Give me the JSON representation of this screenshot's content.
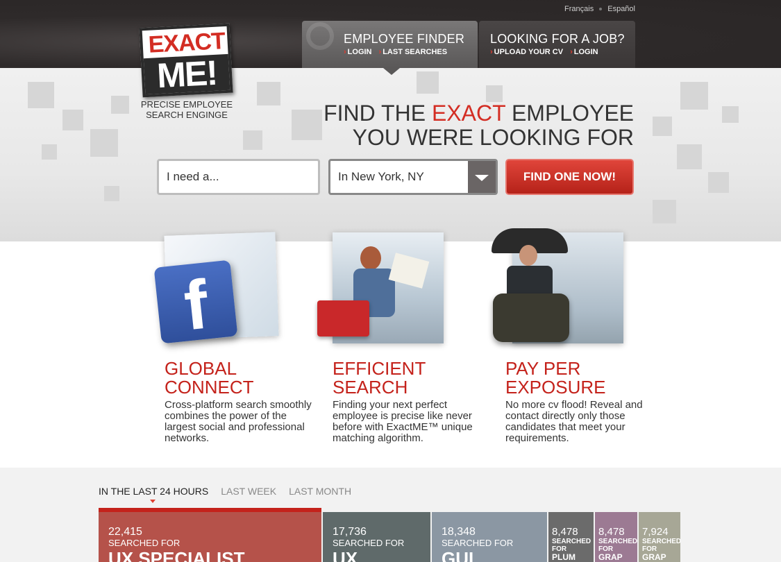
{
  "languages": [
    "Français",
    "Español"
  ],
  "logo": {
    "line1": "EXACT",
    "line2": "ME!",
    "tagline_line1": "PRECISE EMPLOYEE",
    "tagline_line2": "SEARCH ENGINGE"
  },
  "tabs": {
    "employee": {
      "title": "EMPLOYEE FINDER",
      "links": [
        "LOGIN",
        "LAST SEARCHES"
      ]
    },
    "job": {
      "title": "LOOKING FOR A JOB?",
      "links": [
        "UPLOAD YOUR CV",
        "LOGIN"
      ]
    }
  },
  "headline": {
    "pre": "FIND THE ",
    "highlight": "EXACT",
    "post": " EMPLOYEE",
    "line2": "YOU WERE LOOKING FOR"
  },
  "search": {
    "need_placeholder": "I need a...",
    "location": "In New York, NY",
    "button": "FIND ONE NOW!"
  },
  "features": [
    {
      "title1": "GLOBAL",
      "title2": "CONNECT",
      "desc": "Cross-platform search smoothly combines the power of the largest social and professional networks.",
      "icon": "facebook-icon"
    },
    {
      "title1": "EFFICIENT",
      "title2": "SEARCH",
      "desc": "Finding your next perfect employee is precise like never before with ExactME™ unique matching algorithm.",
      "icon": "woman-reading-photo"
    },
    {
      "title1": "PAY PER",
      "title2": "EXPOSURE",
      "desc": "No more cv flood! Reveal and contact directly only those candidates that meet your requirements.",
      "icon": "man-umbrella-photo"
    }
  ],
  "stats": {
    "tabs": [
      "IN THE LAST 24 HOURS",
      "LAST WEEK",
      "LAST MONTH"
    ],
    "tiles": [
      {
        "num": "22,415",
        "label": "SEARCHED FOR",
        "term": "UX SPECIALIST",
        "color": "#b5524a"
      },
      {
        "num": "17,736",
        "label": "SEARCHED FOR",
        "term": "UX",
        "color": "#5f6a6a"
      },
      {
        "num": "18,348",
        "label": "SEARCHED FOR",
        "term": "GUI",
        "color": "#8b97a3"
      },
      {
        "num": "8,478",
        "label": "SEARCHED FOR",
        "term": "PLUM",
        "color": "#6b6b6b"
      },
      {
        "num": "8,478",
        "label": "SEARCHED FOR",
        "term": "GRAP",
        "color": "#9c7a93"
      },
      {
        "num": "7,924",
        "label": "SEARCHED FOR",
        "term": "GRAP",
        "color": "#a7a796"
      }
    ]
  }
}
